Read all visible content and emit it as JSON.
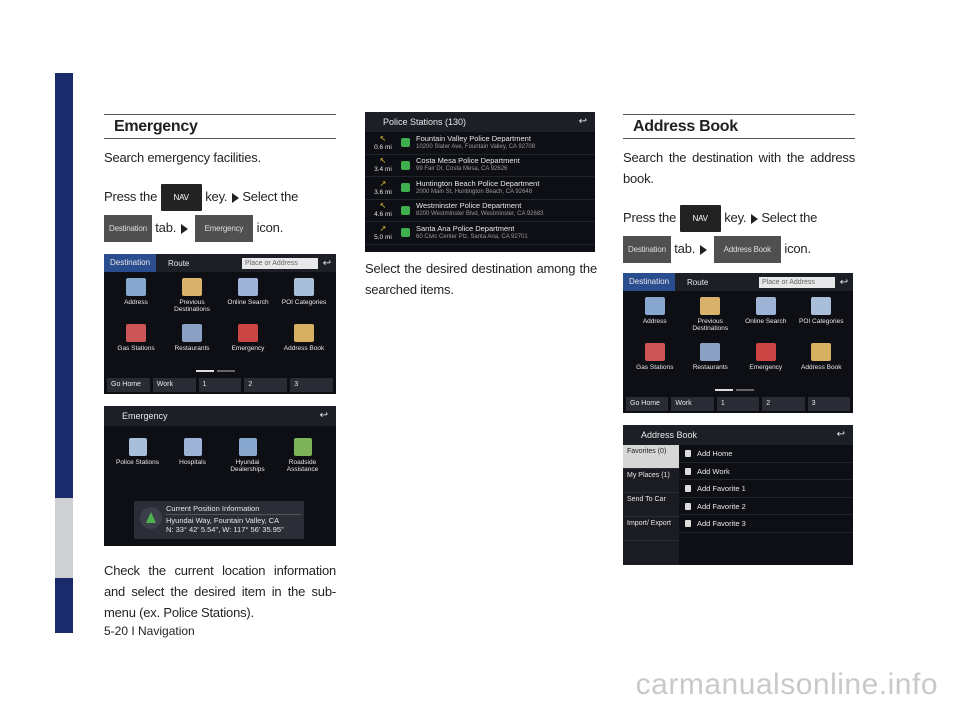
{
  "footer": "5-20 I Navigation",
  "watermark": "carmanualsonline.info",
  "col1": {
    "heading": "Emergency",
    "intro": "Search emergency facilities.",
    "press": "Press the",
    "nav_key": "NAV",
    "key_word": "key.",
    "select_the": "Select the",
    "destination_tab": "Destination",
    "tab_word": "tab.",
    "target_tab": "Emergency",
    "icon_word": "icon.",
    "menu_screen": {
      "tabs": [
        "Destination",
        "Route"
      ],
      "search_placeholder": "Place or Address",
      "tiles": [
        "Address",
        "Previous Destinations",
        "Online Search",
        "POI Categories",
        "Gas Stations",
        "Restaurants",
        "Emergency",
        "Address Book"
      ],
      "bottom": [
        "Go Home",
        "Work",
        "1",
        "2",
        "3"
      ]
    },
    "emergency_screen": {
      "title": "Emergency",
      "tiles": [
        "Police Stations",
        "Hospitals",
        "Hyundai Dealerships",
        "Roadside Assistance"
      ],
      "cpi_title": "Current Position Information",
      "cpi_line1": "Hyundai Way, Fountain Valley, CA",
      "cpi_line2": "N: 33° 42' 5.54\", W: 117° 56' 35.95\""
    },
    "outro": "Check the current location information and select the desired item in the sub-menu (ex. Police Stations)."
  },
  "col2": {
    "police_screen": {
      "title": "Police Stations (130)",
      "rows": [
        {
          "dist": "0.6 mi",
          "name": "Fountain Valley Police Department",
          "addr": "10200 Slater Ave, Fountain Valley, CA 92708"
        },
        {
          "dist": "3.4 mi",
          "name": "Costa Mesa Police Department",
          "addr": "99 Fair Dr, Costa Mesa, CA 92626"
        },
        {
          "dist": "3.6 mi",
          "name": "Huntington Beach Police Department",
          "addr": "2000 Main St, Huntington Beach, CA 92648"
        },
        {
          "dist": "4.6 mi",
          "name": "Westminster Police Department",
          "addr": "8200 Westminster Blvd, Westminster, CA 92683"
        },
        {
          "dist": "5.0 mi",
          "name": "Santa Ana Police Department",
          "addr": "60 Civic Center Plz, Santa Ana, CA 92701"
        }
      ]
    },
    "text": "Select the desired destination among the searched items."
  },
  "col3": {
    "heading": "Address Book",
    "intro": "Search the destination with the address book.",
    "press": "Press the",
    "nav_key": "NAV",
    "key_word": "key.",
    "select_the": "Select the",
    "destination_tab": "Destination",
    "tab_word": "tab.",
    "target_tab": "Address Book",
    "icon_word": "icon.",
    "ab_screen": {
      "title": "Address Book",
      "left": [
        "Favorites (0)",
        "My Places (1)",
        "Send To Car",
        "Import/ Export"
      ],
      "right": [
        "Add Home",
        "Add Work",
        "Add Favorite 1",
        "Add Favorite 2",
        "Add Favorite 3"
      ]
    }
  },
  "colors": {
    "sidebar": "#1b2a6b",
    "screen_bg": "#0e0f14",
    "accent": "#2a4d8f",
    "marker": "#3fae4e"
  }
}
